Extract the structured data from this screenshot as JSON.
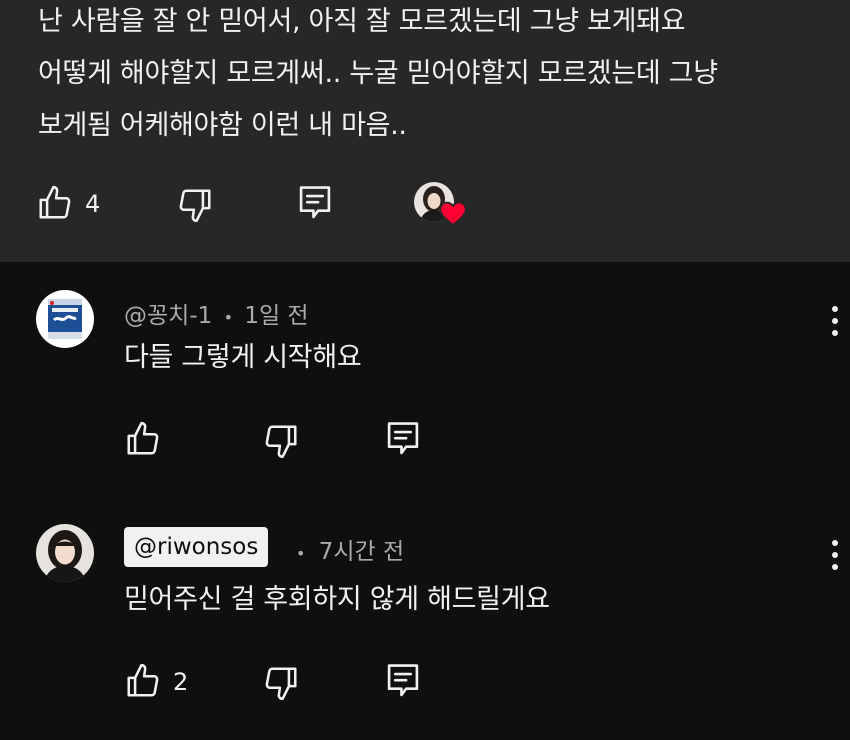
{
  "top_comment": {
    "lines": [
      "난 사람을 잘 안 믿어서, 아직 잘 모르겠는데 그냥 보게돼요",
      "어떻게 해야할지 모르게써.. 누굴 믿어야할지 모르겠는데 그냥",
      "보게됨 어케해야함 이런 내 마음.."
    ],
    "like_count": "4",
    "like_icon": "thumbs-up-icon",
    "dislike_icon": "thumbs-down-icon",
    "reply_icon": "reply-icon",
    "creator_heart": "heart-icon"
  },
  "replies": [
    {
      "handle": "@꽁치-1",
      "separator": "•",
      "time": "1일 전",
      "text": "다들 그렇게 시작해요",
      "like_count": ""
    },
    {
      "handle": "@riwonsos",
      "separator": "•",
      "time": "7시간 전",
      "text": "믿어주신 걸 후회하지 않게 해드릴게요",
      "like_count": "2"
    }
  ],
  "colors": {
    "background": "#0f0f0f",
    "highlight_background": "#272727",
    "text": "#f1f1f1",
    "meta_text": "#aaaaaa",
    "heart": "#ff0033"
  }
}
